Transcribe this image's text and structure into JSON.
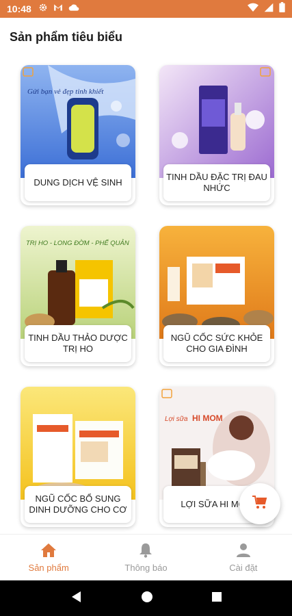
{
  "status": {
    "time": "10:48",
    "left_icons": [
      "gear-icon",
      "gmail-icon",
      "cloud-icon"
    ],
    "right_icons": [
      "wifi-icon",
      "signal-icon",
      "battery-icon"
    ]
  },
  "page": {
    "title": "Sản phẩm tiêu biểu"
  },
  "products": [
    {
      "label": "DUNG DỊCH VỆ SINH"
    },
    {
      "label": "TINH DẦU ĐẶC TRỊ ĐAU NHỨC"
    },
    {
      "label": "TINH DẦU THẢO DƯỢC TRỊ HO"
    },
    {
      "label": "NGŨ CỐC SỨC KHỎE CHO GIA ĐÌNH"
    },
    {
      "label": "NGŨ CỐC BỔ SUNG DINH DƯỠNG CHO CƠ"
    },
    {
      "label": "LỢI SỮA HI MOM"
    }
  ],
  "image_texts": {
    "p1": "Gửi bạn vẻ đẹp tinh khiết",
    "p3": "TRỊ HO - LONG ĐỜM - PHẾ QUẢN",
    "p6_prefix": "Lợi sữa",
    "p6_brand": "HI MOM"
  },
  "bottom_nav": [
    {
      "label": "Sản phẩm"
    },
    {
      "label": "Thông báo"
    },
    {
      "label": "Cài đặt"
    }
  ],
  "colors": {
    "accent": "#e07a3e",
    "inactive": "#9a9a9a"
  }
}
